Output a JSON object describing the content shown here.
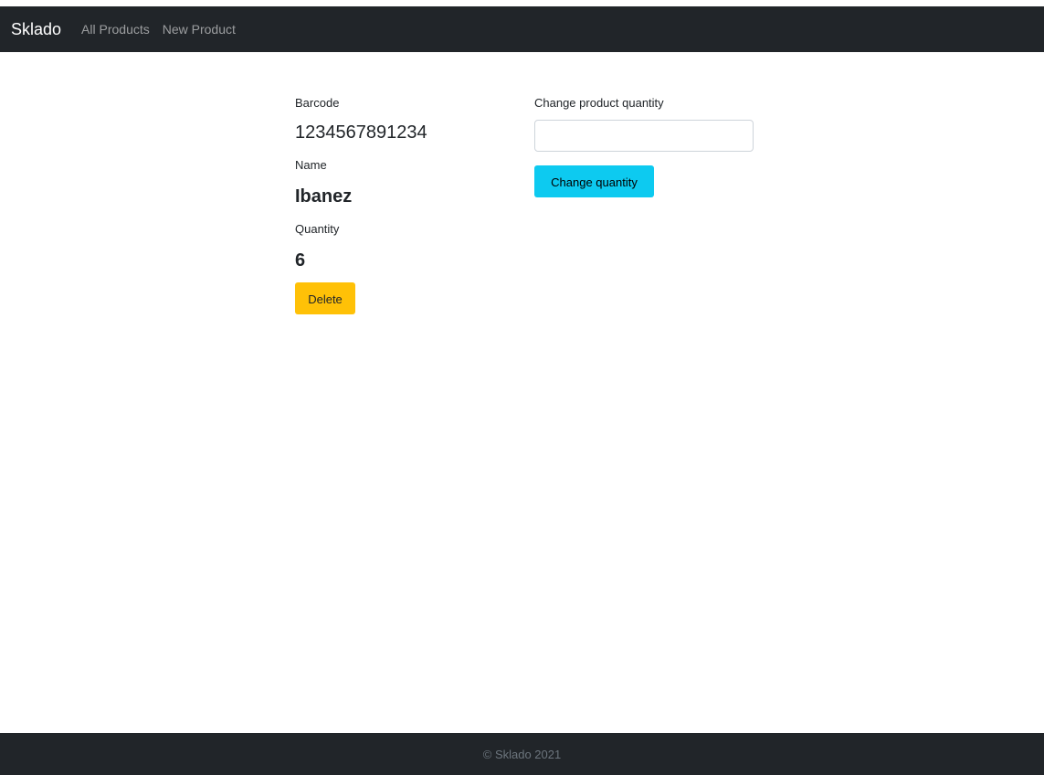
{
  "navbar": {
    "brand": "Sklado",
    "links": [
      "All Products",
      "New Product"
    ]
  },
  "product": {
    "barcode_label": "Barcode",
    "barcode_value": "1234567891234",
    "name_label": "Name",
    "name_value": "Ibanez",
    "quantity_label": "Quantity",
    "quantity_value": "6",
    "delete_label": "Delete"
  },
  "change_form": {
    "label": "Change product quantity",
    "input_value": "",
    "placeholder": "",
    "button_label": "Change quantity"
  },
  "footer": {
    "text": "© Sklado 2021"
  },
  "colors": {
    "navbar_bg": "#212529",
    "delete_button": "#ffc107",
    "change_button": "#0dcaf0",
    "footer_bg": "#212529"
  }
}
